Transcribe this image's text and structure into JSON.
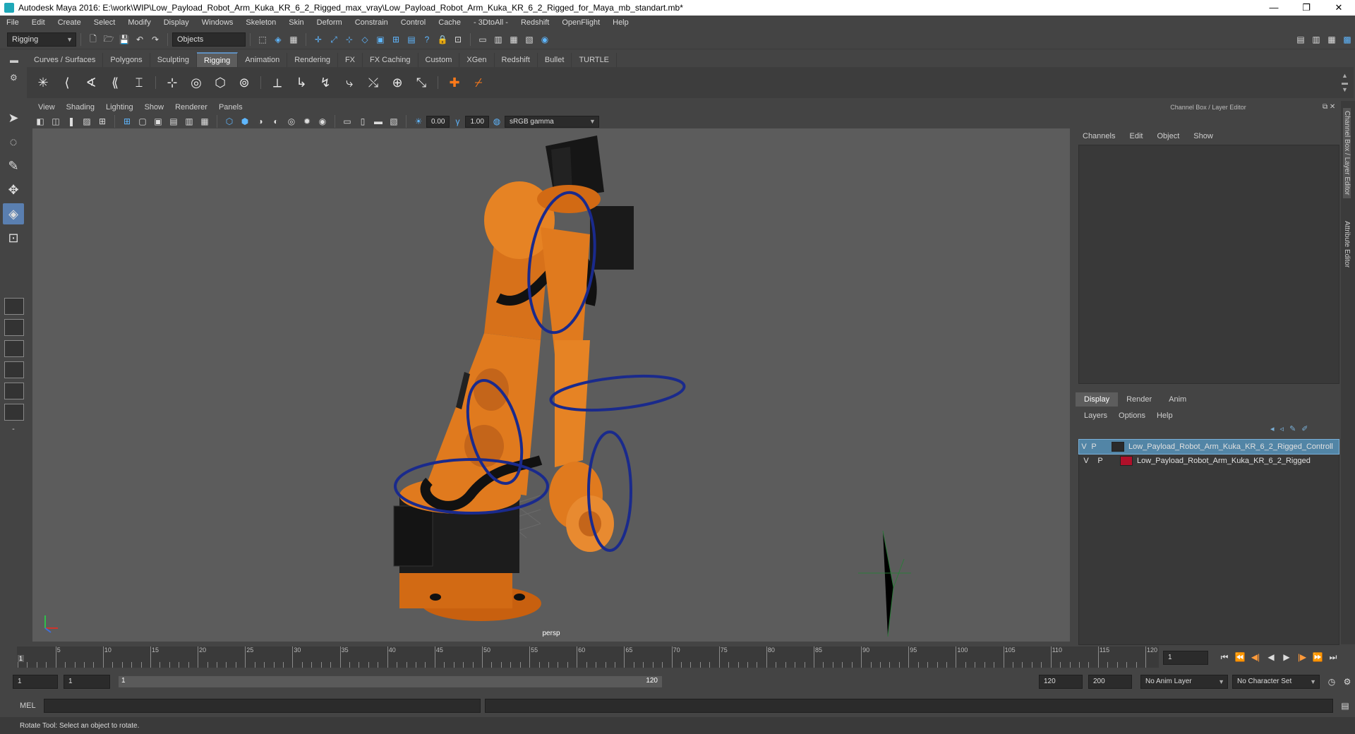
{
  "window": {
    "title": "Autodesk Maya 2016: E:\\work\\WIP\\Low_Payload_Robot_Arm_Kuka_KR_6_2_Rigged_max_vray\\Low_Payload_Robot_Arm_Kuka_KR_6_2_Rigged_for_Maya_mb_standart.mb*",
    "minimize": "—",
    "restore": "❐",
    "close": "✕"
  },
  "menubar": [
    "File",
    "Edit",
    "Create",
    "Select",
    "Modify",
    "Display",
    "Windows",
    "Skeleton",
    "Skin",
    "Deform",
    "Constrain",
    "Control",
    "Cache",
    "- 3DtoAll -",
    "Redshift",
    "OpenFlight",
    "Help"
  ],
  "statusline": {
    "menuset": "Rigging",
    "selection_mode": "Objects"
  },
  "shelf": {
    "tabs": [
      "Curves / Surfaces",
      "Polygons",
      "Sculpting",
      "Rigging",
      "Animation",
      "Rendering",
      "FX",
      "FX Caching",
      "Custom",
      "XGen",
      "Redshift",
      "Bullet",
      "TURTLE"
    ],
    "active_tab": "Rigging"
  },
  "viewport": {
    "menu": [
      "View",
      "Shading",
      "Lighting",
      "Show",
      "Renderer",
      "Panels"
    ],
    "exposure": "0.00",
    "gamma": "1.00",
    "colorspace": "sRGB gamma",
    "camera": "persp"
  },
  "channel_box": {
    "title": "Channel Box / Layer Editor",
    "menu": [
      "Channels",
      "Edit",
      "Object",
      "Show"
    ]
  },
  "layer_editor": {
    "tabs": [
      "Display",
      "Render",
      "Anim"
    ],
    "active_tab": "Display",
    "menu": [
      "Layers",
      "Options",
      "Help"
    ],
    "layers": [
      {
        "v": "V",
        "p": "P",
        "name": "Low_Payload_Robot_Arm_Kuka_KR_6_2_Rigged_Controll",
        "color": "#2a2a2a",
        "selected": true
      },
      {
        "v": "V",
        "p": "P",
        "name": "Low_Payload_Robot_Arm_Kuka_KR_6_2_Rigged",
        "color": "#b0102a",
        "selected": false
      }
    ]
  },
  "side_tabs": [
    "Channel Box / Layer Editor",
    "Attribute Editor"
  ],
  "timeline": {
    "ticks": [
      "5",
      "10",
      "15",
      "20",
      "25",
      "30",
      "35",
      "40",
      "45",
      "50",
      "55",
      "60",
      "65",
      "70",
      "75",
      "80",
      "85",
      "90",
      "95",
      "100",
      "105",
      "110",
      "115",
      "120"
    ],
    "current_frame": "1",
    "current_field": "1"
  },
  "range": {
    "start": "1",
    "playback_start": "1",
    "slider_start": "1",
    "slider_end": "120",
    "playback_end": "120",
    "end": "200",
    "anim_layer": "No Anim Layer",
    "character_set": "No Character Set"
  },
  "command_line": {
    "label": "MEL"
  },
  "help_line": "Rotate Tool: Select an object to rotate."
}
